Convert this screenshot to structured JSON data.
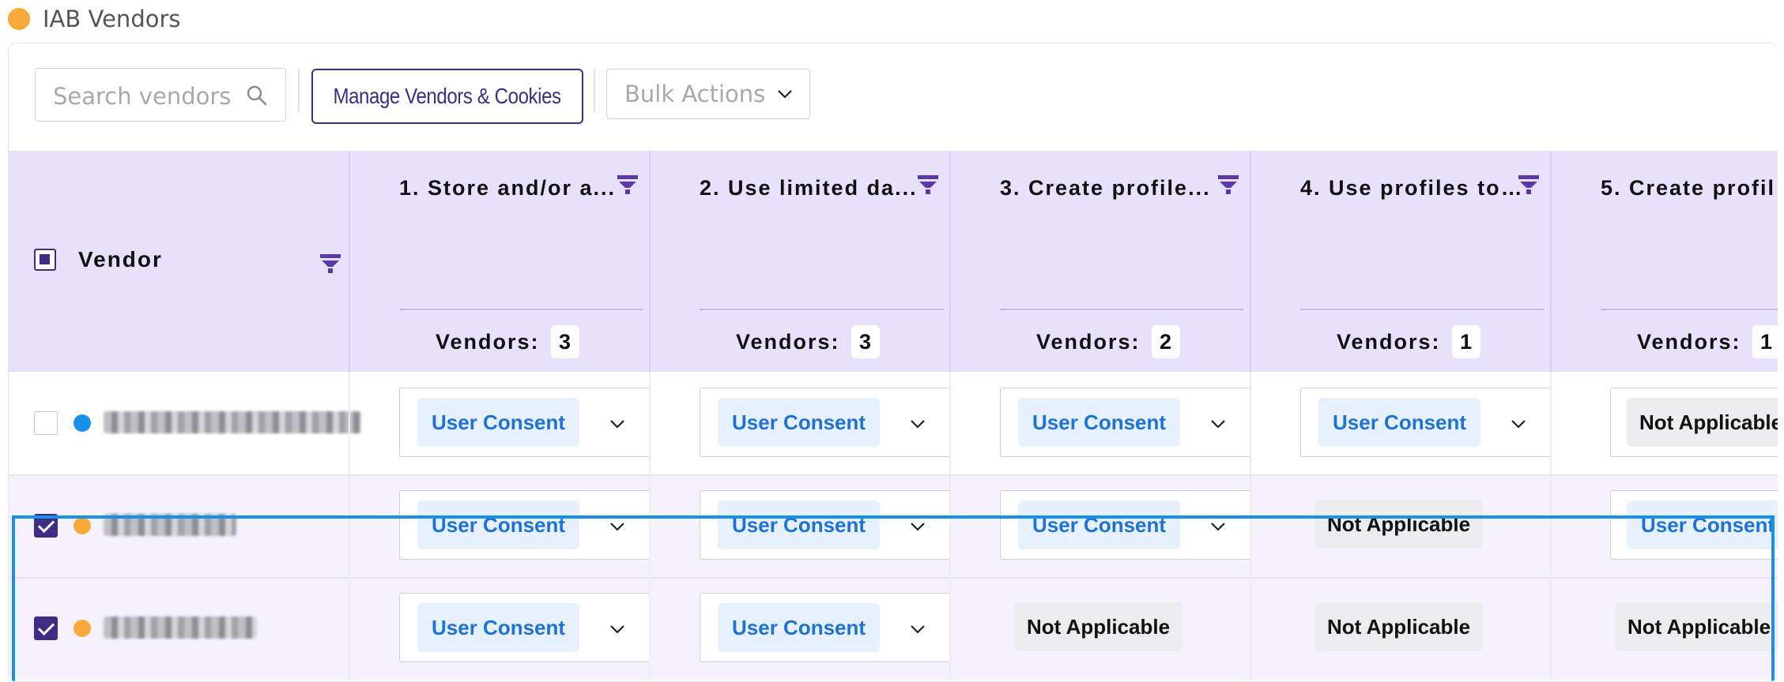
{
  "header": {
    "title": "IAB Vendors",
    "dot_color": "#f8a93a"
  },
  "toolbar": {
    "search_placeholder": "Search vendors",
    "manage_label": "Manage Vendors & Cookies",
    "bulk_label": "Bulk Actions"
  },
  "table": {
    "vendor_header": "Vendor",
    "purposes": [
      {
        "title": "1. Store and/or a...",
        "count_label": "Vendors:",
        "count": "3"
      },
      {
        "title": "2. Use limited da...",
        "count_label": "Vendors:",
        "count": "3"
      },
      {
        "title": "3. Create profile...",
        "count_label": "Vendors:",
        "count": "2"
      },
      {
        "title": "4. Use profiles to...",
        "count_label": "Vendors:",
        "count": "1"
      },
      {
        "title": "5. Create profil",
        "count_label": "Vendors:",
        "count": "1"
      }
    ],
    "rows": [
      {
        "checked": false,
        "dot_color": "#1791e9",
        "cells": [
          {
            "type": "select",
            "label": "User Consent"
          },
          {
            "type": "select",
            "label": "User Consent"
          },
          {
            "type": "select",
            "label": "User Consent"
          },
          {
            "type": "select",
            "label": "User Consent"
          },
          {
            "type": "select-na",
            "label": "Not Applicable"
          }
        ]
      },
      {
        "checked": true,
        "dot_color": "#f8a93a",
        "cells": [
          {
            "type": "select",
            "label": "User Consent"
          },
          {
            "type": "select",
            "label": "User Consent"
          },
          {
            "type": "select",
            "label": "User Consent"
          },
          {
            "type": "na",
            "label": "Not Applicable"
          },
          {
            "type": "select-pill",
            "label": "User Consent"
          }
        ]
      },
      {
        "checked": true,
        "dot_color": "#f8a93a",
        "cells": [
          {
            "type": "select",
            "label": "User Consent"
          },
          {
            "type": "select",
            "label": "User Consent"
          },
          {
            "type": "na",
            "label": "Not Applicable"
          },
          {
            "type": "na",
            "label": "Not Applicable"
          },
          {
            "type": "na",
            "label": "Not Applicable"
          }
        ]
      }
    ]
  },
  "colors": {
    "accent": "#3f2c85",
    "header_bg": "#e8e1fb",
    "highlight": "#1791e9",
    "pill_text": "#1e72d6"
  }
}
